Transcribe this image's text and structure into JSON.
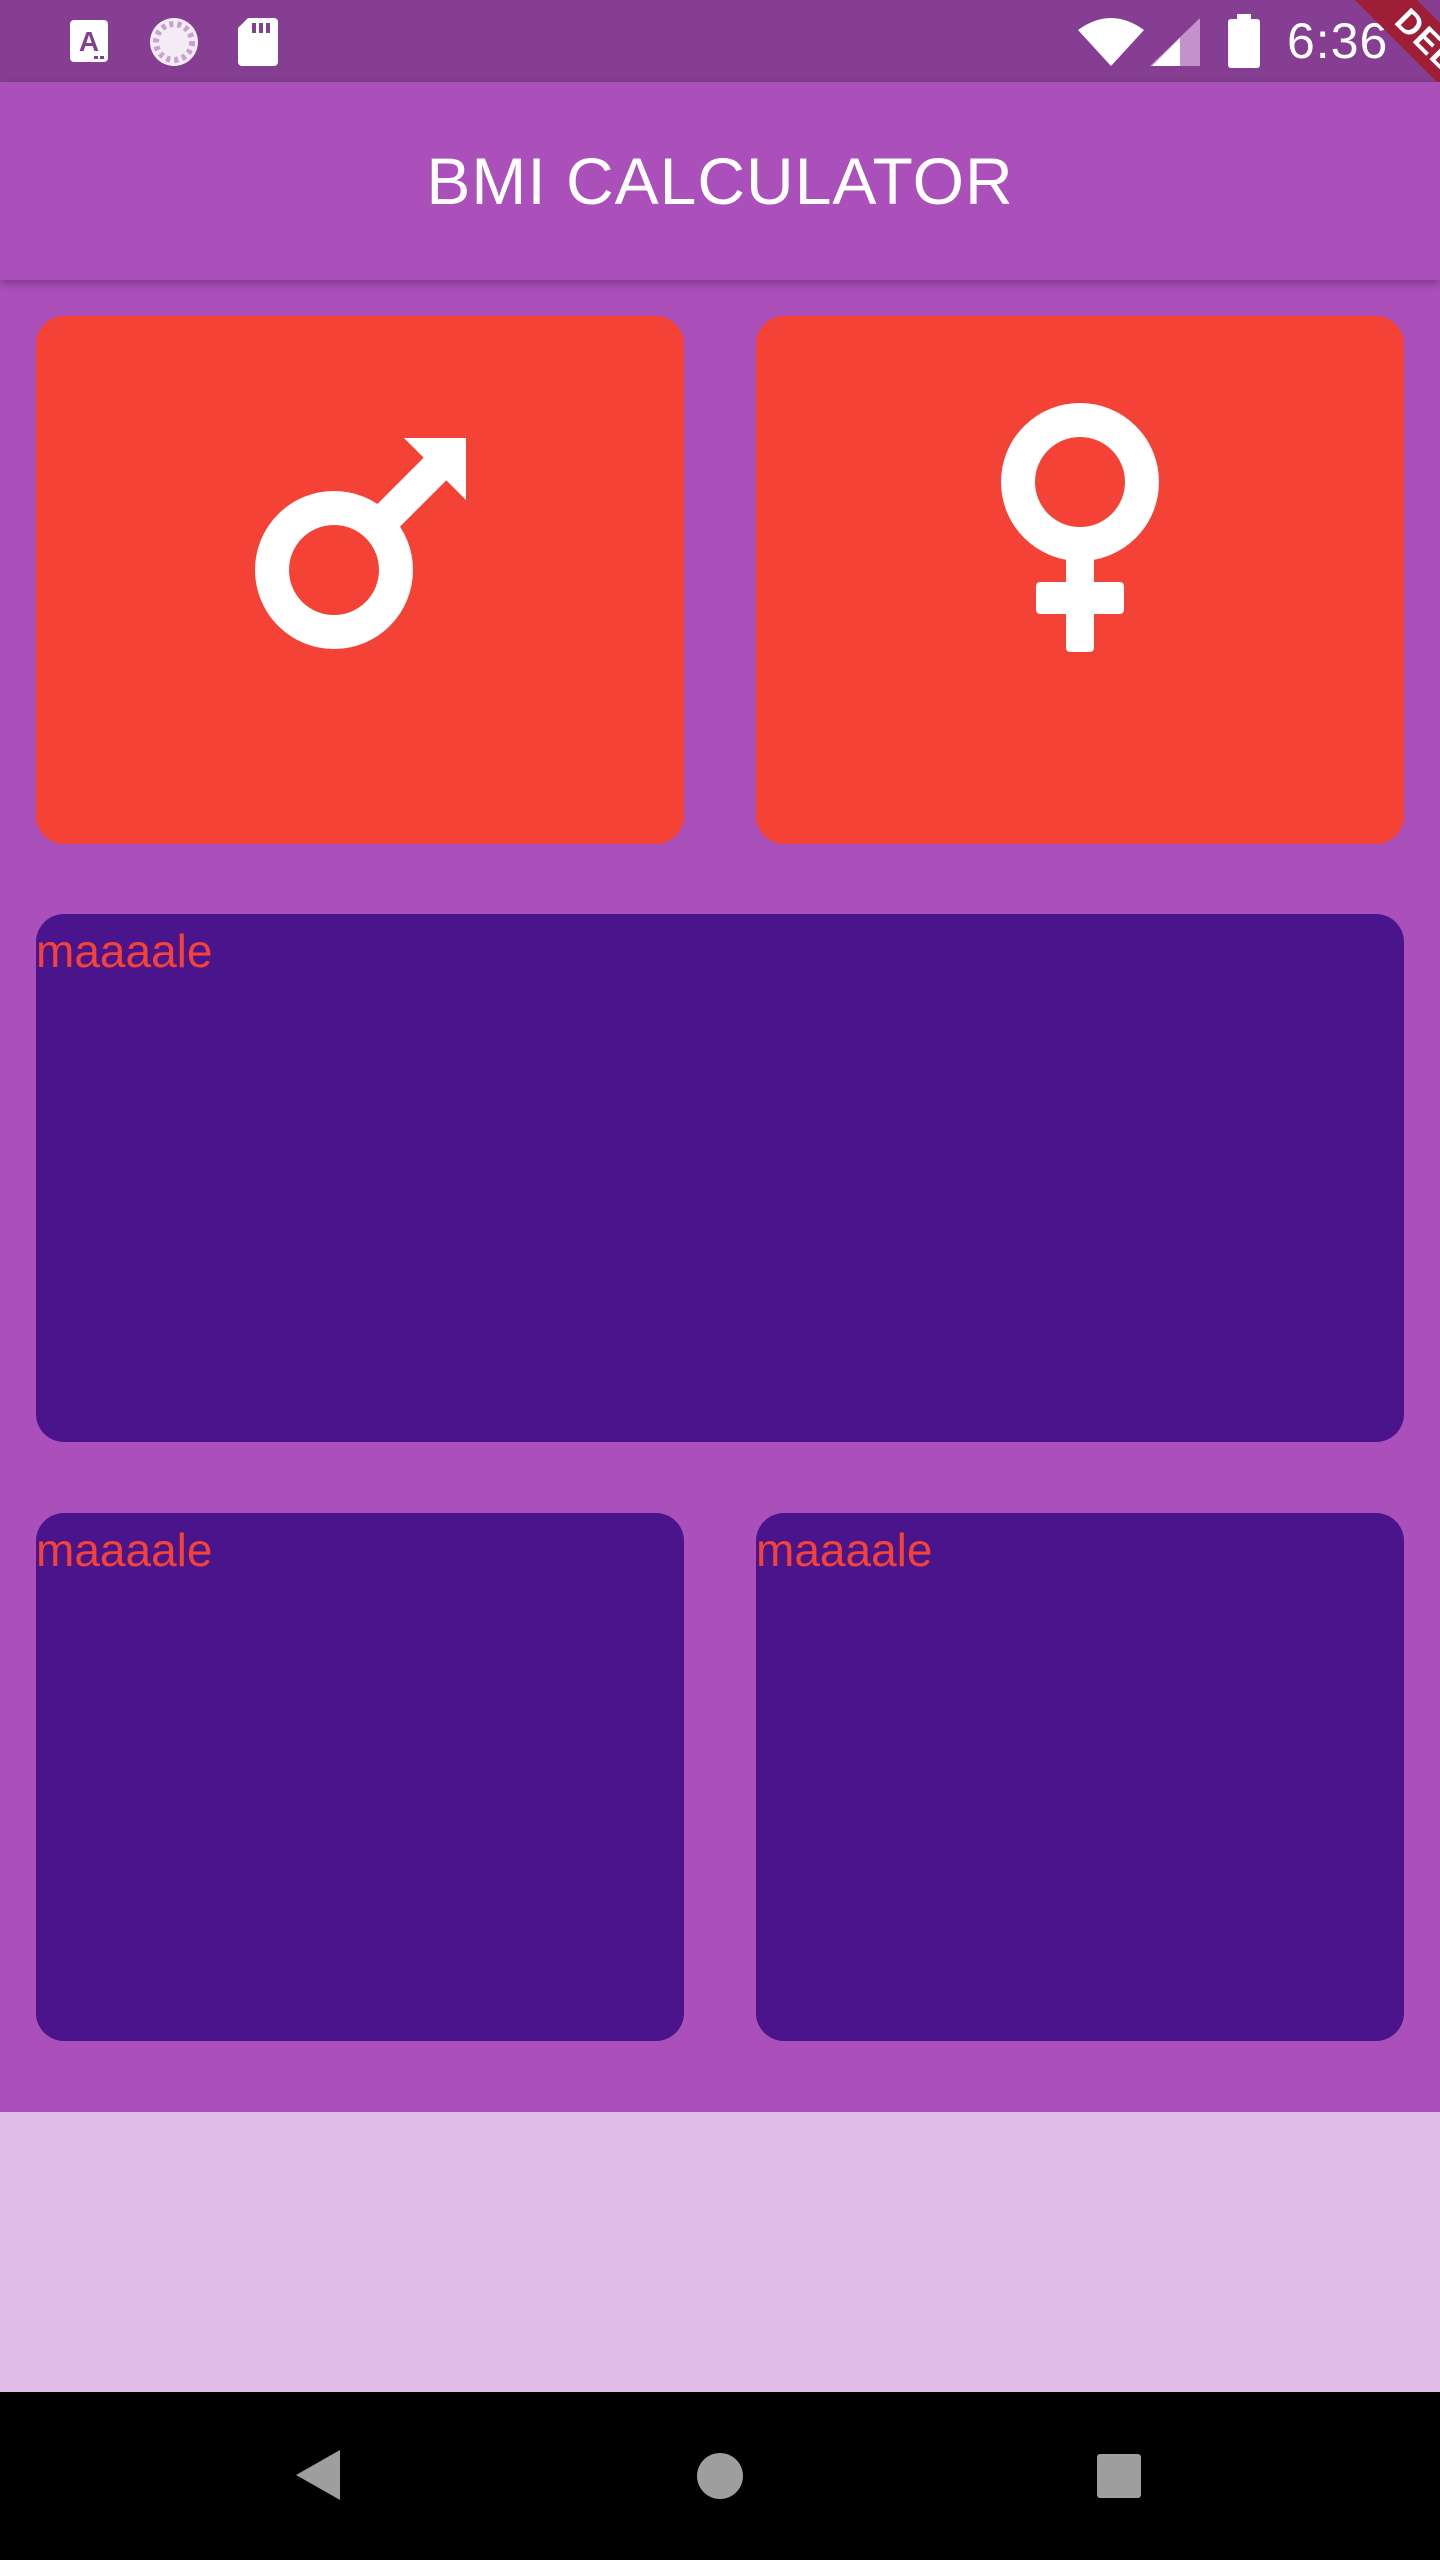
{
  "status_bar": {
    "time": "6:36",
    "left_icons": [
      "font-app-icon",
      "loading-icon",
      "sd-card-icon"
    ],
    "right_icons": [
      "wifi-icon",
      "cell-signal-icon",
      "battery-icon"
    ]
  },
  "debug_banner": {
    "label": "DEBUG"
  },
  "app_bar": {
    "title": "BMI CALCULATOR"
  },
  "gender_cards": [
    {
      "icon": "male-icon"
    },
    {
      "icon": "female-icon"
    }
  ],
  "cards": {
    "middle": {
      "label": "maaaale"
    },
    "bottom_left": {
      "label": "maaaale"
    },
    "bottom_right": {
      "label": "maaaale"
    }
  },
  "colors": {
    "background": "#ab4fbb",
    "status_bar": "#853e91",
    "gender_card": "#f44336",
    "card": "#4a148c",
    "card_text": "#f44336",
    "bottom_area": "#e1bee7"
  },
  "nav_bar": {
    "buttons": [
      "back-icon",
      "home-icon",
      "recents-icon"
    ]
  }
}
